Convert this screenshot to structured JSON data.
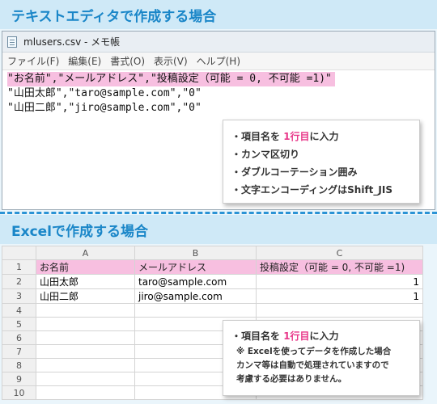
{
  "section1": {
    "title": "テキストエディタで作成する場合"
  },
  "notepad": {
    "window_title": "mlusers.csv - メモ帳",
    "menu": [
      "ファイル(F)",
      "編集(E)",
      "書式(O)",
      "表示(V)",
      "ヘルプ(H)"
    ],
    "lines": [
      "\"お名前\",\"メールアドレス\",\"投稿設定（可能 = 0, 不可能 =1)\"",
      "\"山田太郎\",\"taro@sample.com\",\"0\"",
      "\"山田二郎\",\"jiro@sample.com\",\"0\""
    ]
  },
  "callout1": {
    "b1_pre": "・項目名を ",
    "b1_em": "1行目",
    "b1_post": "に入力",
    "b2": "・カンマ区切り",
    "b3": "・ダブルコーテーション囲み",
    "b4": "・文字エンコーディングはShift_JIS"
  },
  "section2": {
    "title": "Excelで作成する場合"
  },
  "excel": {
    "columns": [
      "A",
      "B",
      "C"
    ],
    "row_numbers": [
      "1",
      "2",
      "3",
      "4",
      "5",
      "6",
      "7",
      "8",
      "9",
      "10"
    ],
    "rows": [
      [
        "お名前",
        "メールアドレス",
        "投稿設定（可能 = 0, 不可能 =1)"
      ],
      [
        "山田太郎",
        "taro@sample.com",
        "1"
      ],
      [
        "山田二郎",
        "jiro@sample.com",
        "1"
      ],
      [
        "",
        "",
        ""
      ],
      [
        "",
        "",
        ""
      ],
      [
        "",
        "",
        ""
      ],
      [
        "",
        "",
        ""
      ],
      [
        "",
        "",
        ""
      ],
      [
        "",
        "",
        ""
      ],
      [
        "",
        "",
        ""
      ]
    ]
  },
  "callout2": {
    "b1_pre": "・項目名を ",
    "b1_em": "1行目",
    "b1_post": "に入力",
    "note1": "※ Excelを使ってデータを作成した場合",
    "note2": "カンマ等は自動で処理されていますので",
    "note3": "考慮する必要はありません。"
  },
  "colors": {
    "accent": "#1a86c8",
    "highlight": "#f7bfe0",
    "emphasis": "#e8388a"
  }
}
